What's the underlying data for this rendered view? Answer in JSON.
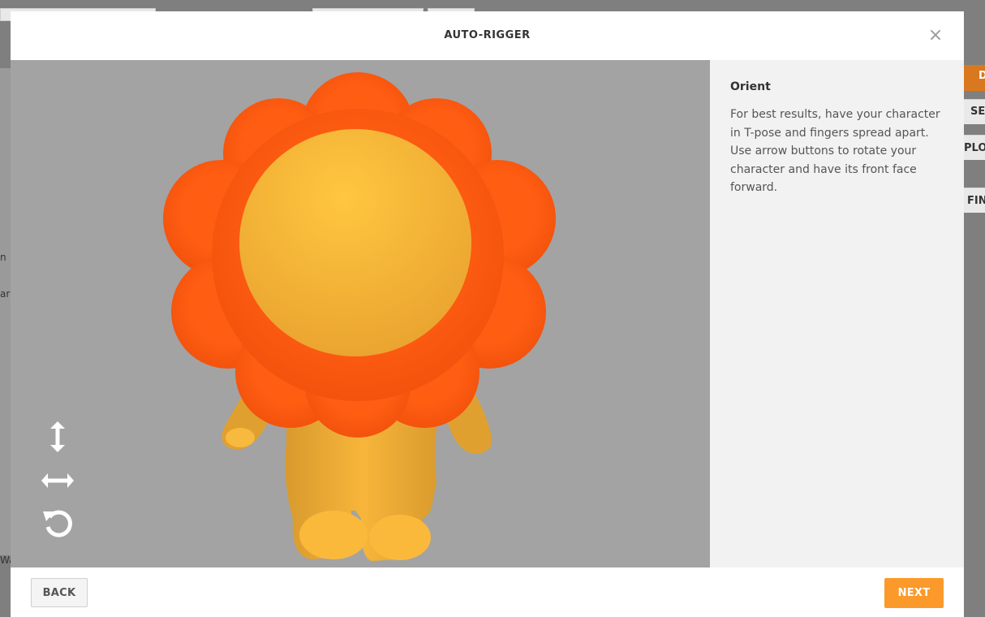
{
  "modal": {
    "title": "AUTO-RIGGER",
    "close_icon": "×"
  },
  "side_panel": {
    "step_title": "Orient",
    "step_description": "For best results, have your character in T-pose and fingers spread apart. Use arrow buttons to rotate your character and have its front face forward."
  },
  "toolbar": {
    "tools": [
      {
        "name": "rotate-vertical",
        "icon": "vertical-arrows-icon"
      },
      {
        "name": "rotate-horizontal",
        "icon": "horizontal-arrows-icon"
      },
      {
        "name": "reset-rotation",
        "icon": "rotate-ccw-icon"
      }
    ]
  },
  "footer": {
    "back_label": "BACK",
    "next_label": "NEXT"
  },
  "background_app": {
    "edge_labels": [
      "D",
      "SE",
      "PLO",
      "FIN",
      "n",
      "ar",
      "Wa"
    ]
  },
  "colors": {
    "accent": "#fb9a2b",
    "viewport_bg": "#a3a3a3",
    "mane": "#ff5a10",
    "body": "#f9b93a"
  }
}
